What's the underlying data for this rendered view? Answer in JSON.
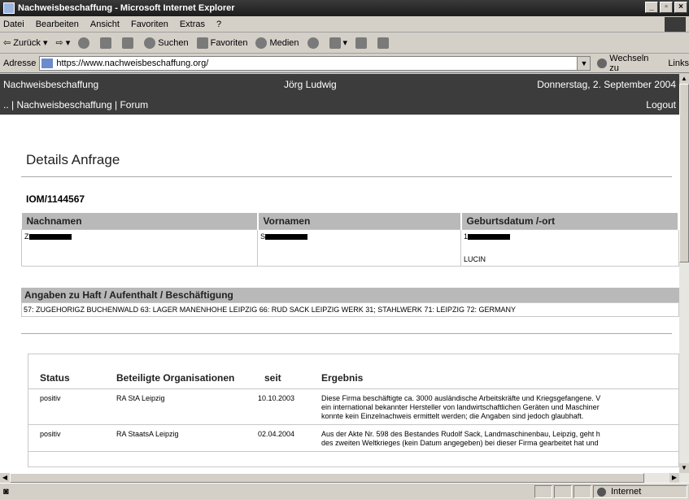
{
  "window": {
    "title": "Nachweisbeschaffung - Microsoft Internet Explorer"
  },
  "menu": [
    "Datei",
    "Bearbeiten",
    "Ansicht",
    "Favoriten",
    "Extras",
    "?"
  ],
  "toolbar": {
    "back": "Zurück",
    "search": "Suchen",
    "favorites": "Favoriten",
    "media": "Medien"
  },
  "address": {
    "label": "Adresse",
    "url": "https://www.nachweisbeschaffung.org/",
    "go": "Wechseln zu",
    "links": "Links"
  },
  "header": {
    "site": "Nachweisbeschaffung",
    "user": "Jörg Ludwig",
    "date": "Donnerstag, 2. September 2004",
    "nav_prefix": ".. |",
    "nav_home": "Nachweisbeschaffung",
    "nav_sep": "|",
    "nav_forum": "Forum",
    "logout": "Logout"
  },
  "page": {
    "title": "Details Anfrage",
    "case_id": "IOM/1144567"
  },
  "person": {
    "headers": [
      "Nachnamen",
      "Vornamen",
      "Geburtsdatum /-ort"
    ],
    "surname_initial": "Z",
    "firstname_initial": "S",
    "birthdate_initial": "1",
    "birthplace": "LUCIN"
  },
  "detention": {
    "heading": "Angaben zu Haft / Aufenthalt / Beschäftigung",
    "text": "57: ZUGEHORIGZ BUCHENWALD 63: LAGER MANENHOHE LEIPZIG 66: RUD SACK LEIPZIG WERK 31; STAHLWERK 71: LEIPZIG 72: GERMANY"
  },
  "results": {
    "headers": [
      "Status",
      "Beteiligte Organisationen",
      "seit",
      "Ergebnis"
    ],
    "rows": [
      {
        "status": "positiv",
        "org": "RA StA Leipzig",
        "since": "10.10.2003",
        "result_lines": [
          "Diese Firma beschäftigte ca. 3000 ausländische Arbeitskräfte und Kriegsgefangene. V",
          "ein international bekannter Hersteller von landwirtschaftlichen Geräten und Maschiner",
          "konnte kein Einzelnachweis ermittelt werden; die Angaben sind jedoch glaubhaft."
        ]
      },
      {
        "status": "positiv",
        "org": "RA StaatsA Leipzig",
        "since": "02.04.2004",
        "result_lines": [
          "Aus der Akte Nr. 598 des Bestandes Rudolf Sack, Landmaschinenbau, Leipzig, geht h",
          "des zweiten Weltkrieges (kein Datum angegeben) bei dieser Firma gearbeitet hat und"
        ]
      }
    ]
  },
  "statusbar": {
    "zone": "Internet"
  }
}
